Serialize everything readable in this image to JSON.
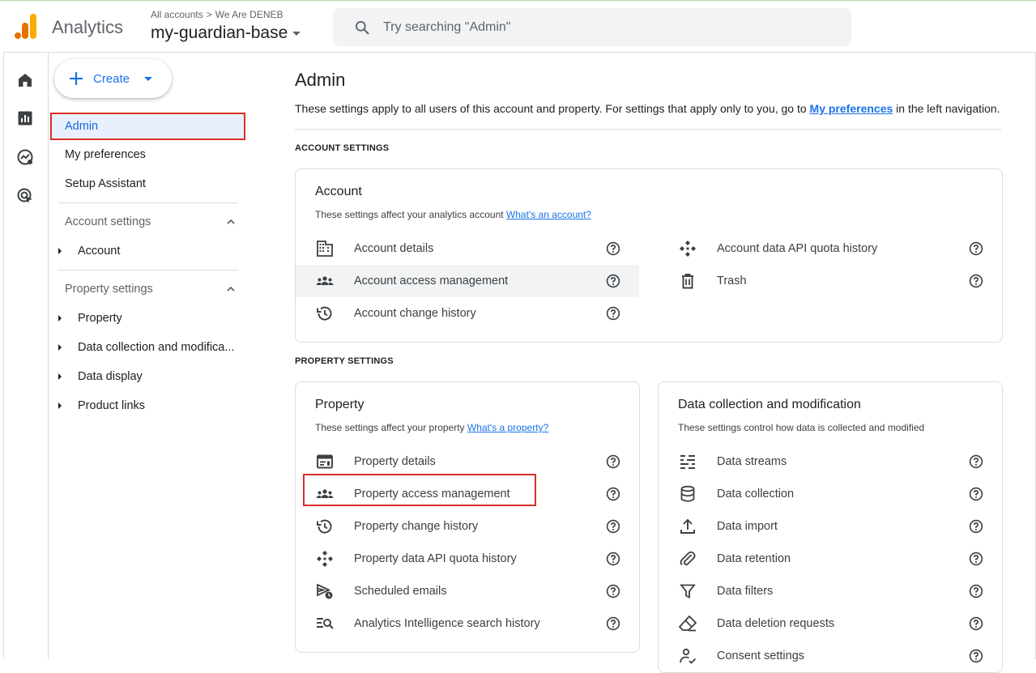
{
  "app": {
    "name": "Analytics",
    "breadcrumb_all": "All accounts",
    "breadcrumb_account": "We Are DENEB",
    "property_name": "my-guardian-base"
  },
  "search": {
    "placeholder": "Try searching \"Admin\""
  },
  "create": {
    "label": "Create"
  },
  "nav": {
    "admin": "Admin",
    "my_preferences": "My preferences",
    "setup_assistant": "Setup Assistant",
    "account_settings": "Account settings",
    "account": "Account",
    "property_settings": "Property settings",
    "property": "Property",
    "data_collection": "Data collection and modifica...",
    "data_display": "Data display",
    "product_links": "Product links"
  },
  "page": {
    "title": "Admin",
    "desc_prefix": "These settings apply to all users of this account and property. For settings that apply only to you, go to ",
    "desc_link": "My preferences",
    "desc_suffix": " in the left navigation.",
    "account_settings_label": "ACCOUNT SETTINGS",
    "property_settings_label": "PROPERTY SETTINGS"
  },
  "account_card": {
    "title": "Account",
    "subtitle": "These settings affect your analytics account ",
    "subtitle_link": "What's an account?",
    "left": [
      "Account details",
      "Account access management",
      "Account change history"
    ],
    "right": [
      "Account data API quota history",
      "Trash"
    ]
  },
  "property_card": {
    "title": "Property",
    "subtitle": "These settings affect your property ",
    "subtitle_link": "What's a property?",
    "items": [
      "Property details",
      "Property access management",
      "Property change history",
      "Property data API quota history",
      "Scheduled emails",
      "Analytics Intelligence search history"
    ]
  },
  "data_card": {
    "title": "Data collection and modification",
    "subtitle": "These settings control how data is collected and modified",
    "items": [
      "Data streams",
      "Data collection",
      "Data import",
      "Data retention",
      "Data filters",
      "Data deletion requests",
      "Consent settings"
    ]
  },
  "colors": {
    "accent": "#1a73e8",
    "highlight_box": "#d93025",
    "logo_orange": "#f9ab00",
    "logo_dark_orange": "#e37400"
  }
}
